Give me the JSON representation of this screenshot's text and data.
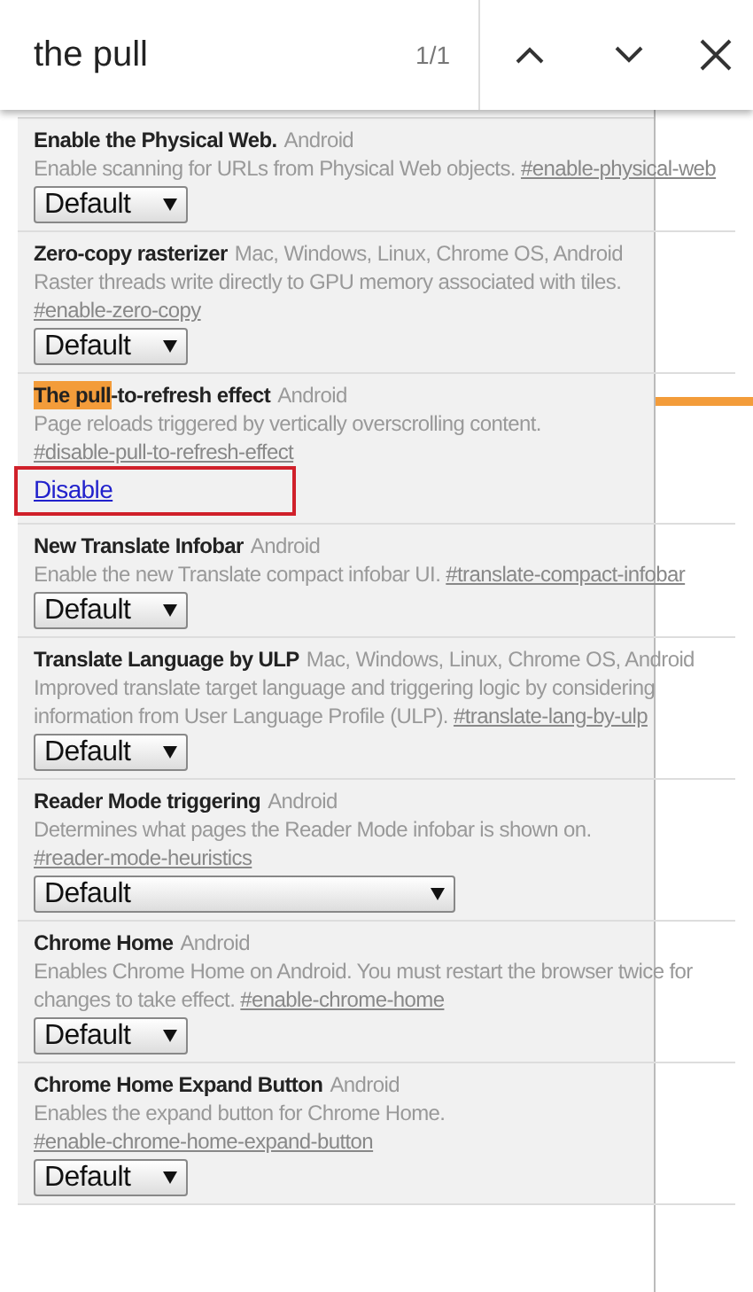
{
  "find_bar": {
    "query": "the pull",
    "match_count": "1/1"
  },
  "flags": [
    {
      "name": "Enable the Physical Web.",
      "platforms": "Android",
      "description": "Enable scanning for URLs from Physical Web objects.",
      "hash": "#enable-physical-web",
      "control": {
        "kind": "select",
        "label": "Default"
      }
    },
    {
      "name": "Zero-copy rasterizer",
      "platforms": "Mac, Windows, Linux, Chrome OS, Android",
      "description": "Raster threads write directly to GPU memory associated with tiles.",
      "hash": "#enable-zero-copy",
      "control": {
        "kind": "select",
        "label": "Default"
      }
    },
    {
      "name_match": "The pull",
      "name": "-to-refresh effect",
      "platforms": "Android",
      "description": "Page reloads triggered by vertically overscrolling content.",
      "hash": "#disable-pull-to-refresh-effect",
      "control": {
        "kind": "link",
        "label": "Disable",
        "highlighted": true
      }
    },
    {
      "name": "New Translate Infobar",
      "platforms": "Android",
      "description": "Enable the new Translate compact infobar UI.",
      "hash": "#translate-compact-infobar",
      "control": {
        "kind": "select",
        "label": "Default"
      }
    },
    {
      "name": "Translate Language by ULP",
      "platforms": "Mac, Windows, Linux, Chrome OS, Android",
      "description": "Improved translate target language and triggering logic by considering information from User Language Profile (ULP).",
      "hash": "#translate-lang-by-ulp",
      "control": {
        "kind": "select",
        "label": "Default"
      }
    },
    {
      "name": "Reader Mode triggering",
      "platforms": "Android",
      "description": "Determines what pages the Reader Mode infobar is shown on.",
      "hash": "#reader-mode-heuristics",
      "control": {
        "kind": "select-wide",
        "label": "Default"
      }
    },
    {
      "name": "Chrome Home",
      "platforms": "Android",
      "description": "Enables Chrome Home on Android. You must restart the browser twice for changes to take effect.",
      "hash": "#enable-chrome-home",
      "control": {
        "kind": "select",
        "label": "Default"
      }
    },
    {
      "name": "Chrome Home Expand Button",
      "platforms": "Android",
      "description": "Enables the expand button for Chrome Home.",
      "hash": "#enable-chrome-home-expand-button",
      "control": {
        "kind": "select",
        "label": "Default"
      }
    }
  ]
}
